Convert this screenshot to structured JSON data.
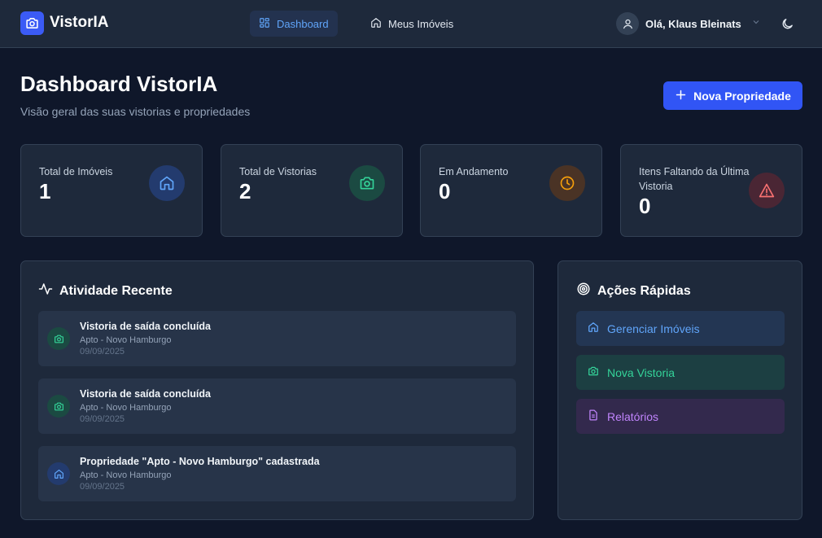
{
  "app": {
    "name": "VistorIA"
  },
  "nav": {
    "items": [
      {
        "label": "Dashboard",
        "icon": "grid-icon",
        "active": true
      },
      {
        "label": "Meus Imóveis",
        "icon": "home-icon",
        "active": false
      }
    ]
  },
  "user": {
    "greeting": "Olá, Klaus Bleinats"
  },
  "header": {
    "title": "Dashboard VistorIA",
    "subtitle": "Visão geral das suas vistorias e propriedades",
    "new_button": "Nova Propriedade"
  },
  "stats": [
    {
      "label": "Total de Imóveis",
      "value": "1",
      "icon": "home-icon",
      "color": "#60a5fa"
    },
    {
      "label": "Total de Vistorias",
      "value": "2",
      "icon": "camera-icon",
      "color": "#34d399"
    },
    {
      "label": "Em Andamento",
      "value": "0",
      "icon": "clock-icon",
      "color": "#f59e0b"
    },
    {
      "label": "Itens Faltando da Última Vistoria",
      "value": "0",
      "icon": "alert-triangle-icon",
      "color": "#f87171"
    }
  ],
  "activity": {
    "title": "Atividade Recente",
    "items": [
      {
        "title": "Vistoria de saída concluída",
        "property": "Apto - Novo Hamburgo",
        "date": "09/09/2025",
        "icon": "camera-icon"
      },
      {
        "title": "Vistoria de saída concluída",
        "property": "Apto - Novo Hamburgo",
        "date": "09/09/2025",
        "icon": "camera-icon"
      },
      {
        "title": "Propriedade \"Apto - Novo Hamburgo\" cadastrada",
        "property": "Apto - Novo Hamburgo",
        "date": "09/09/2025",
        "icon": "home-icon"
      }
    ]
  },
  "quick_actions": {
    "title": "Ações Rápidas",
    "items": [
      {
        "label": "Gerenciar Imóveis",
        "icon": "home-icon",
        "color": "#60a5fa"
      },
      {
        "label": "Nova Vistoria",
        "icon": "camera-icon",
        "color": "#34d399"
      },
      {
        "label": "Relatórios",
        "icon": "document-icon",
        "color": "#c084fc"
      }
    ]
  }
}
